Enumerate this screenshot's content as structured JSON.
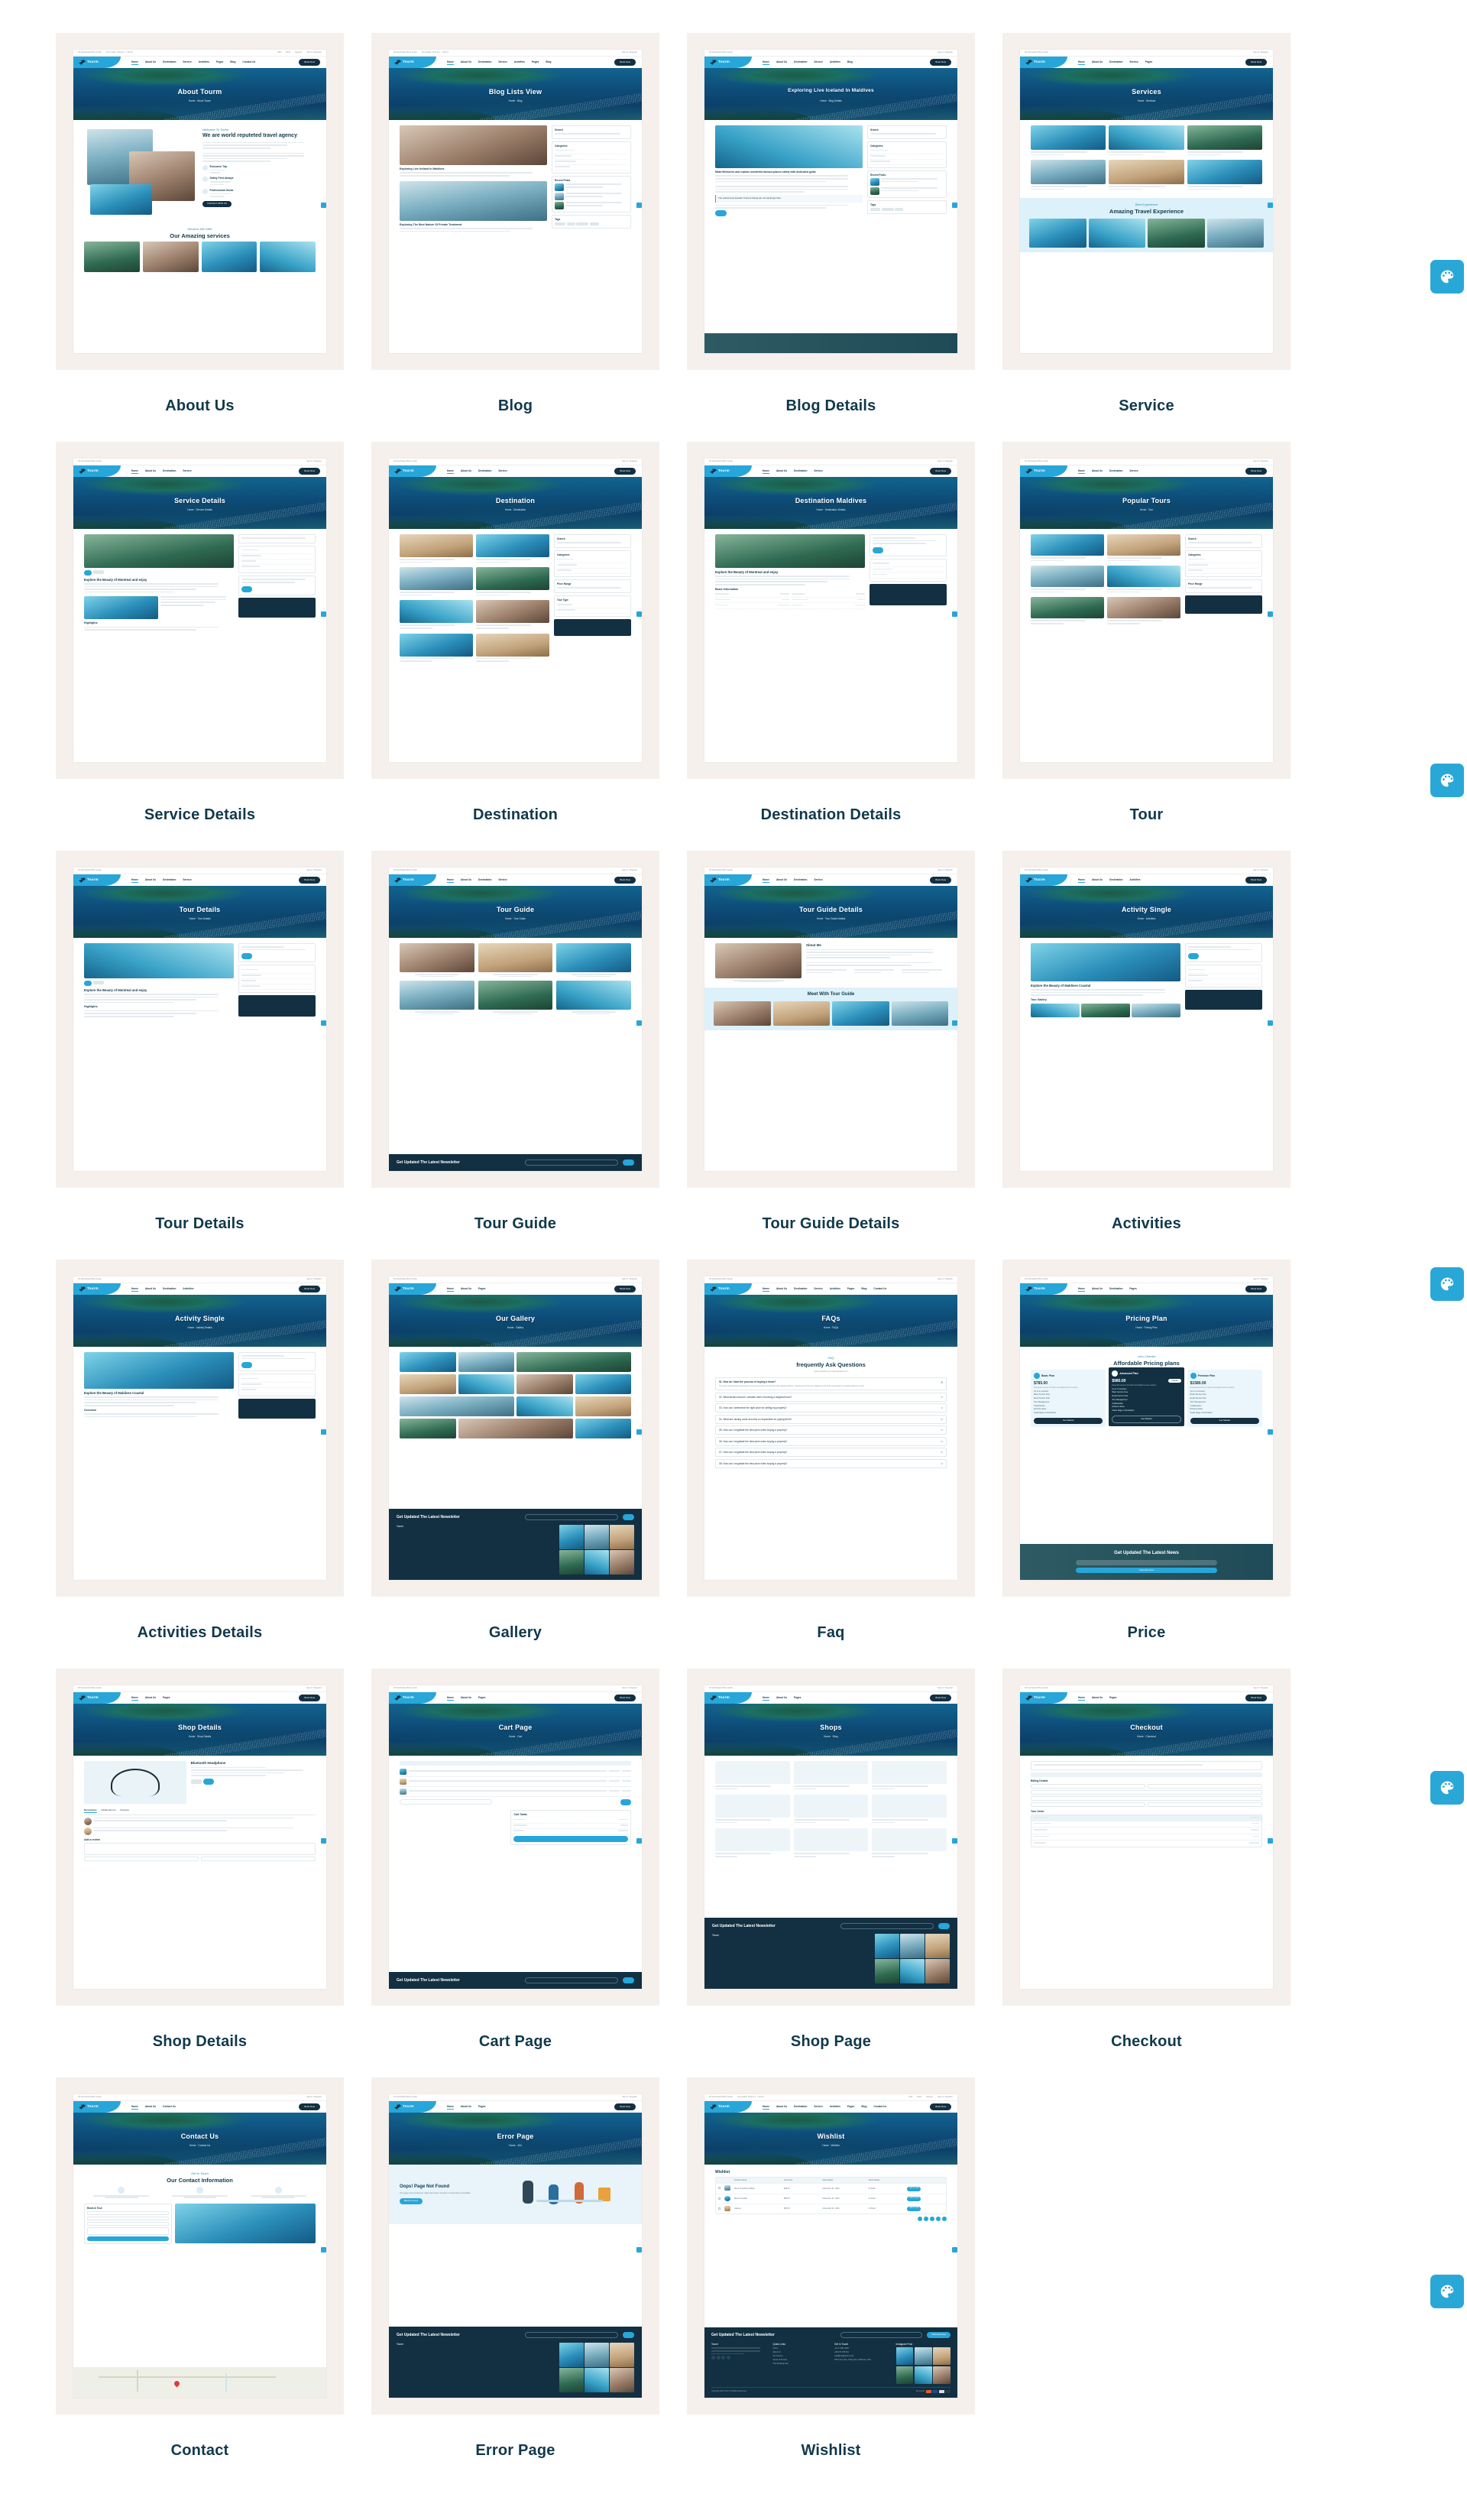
{
  "page": {
    "background": "#ffffff",
    "card_background": "#f5f0ec",
    "label_color": "#11394b",
    "accent": "#27a6d9",
    "dark": "#123042"
  },
  "brand": {
    "name": "Tourm",
    "tagline": "Explore World",
    "topbar_left": [
      "25 Southwater Blvd, Austin",
      "Sun-Friday: 8.00 am - 7.00 pm"
    ],
    "topbar_right": [
      "USD",
      "ENG",
      "Support",
      "Sign In / Register"
    ],
    "nav": [
      {
        "label": "Home",
        "active": true
      },
      {
        "label": "About Us",
        "active": false
      },
      {
        "label": "Destination",
        "active": false
      },
      {
        "label": "Service",
        "active": false
      },
      {
        "label": "Activities",
        "active": false
      },
      {
        "label": "Pages",
        "active": false
      },
      {
        "label": "Blog",
        "active": false
      },
      {
        "label": "Contact Us",
        "active": false
      }
    ],
    "nav_button": "Book Now"
  },
  "fabs": [
    {
      "name": "palette-button-1",
      "icon": "palette-icon"
    },
    {
      "name": "palette-button-2",
      "icon": "palette-icon"
    },
    {
      "name": "palette-button-3",
      "icon": "palette-icon"
    },
    {
      "name": "palette-button-4",
      "icon": "palette-icon"
    },
    {
      "name": "palette-button-5",
      "icon": "palette-icon"
    },
    {
      "name": "palette-button-6",
      "icon": "palette-icon"
    }
  ],
  "cards": [
    {
      "label": "About Us",
      "hero_title": "About Tourm",
      "breadcrumb": "Home  ·  About Tourm",
      "script_sub": "Welcome To Tourm",
      "headline": "We are world reputeted travel agency",
      "features": [
        "Exclusive Trip",
        "Safety First Always",
        "Professional Guide"
      ],
      "cta": "CONTACT WITH US",
      "section2_sub": "Services We Offer",
      "section2_title": "Our Amazing services"
    },
    {
      "label": "Blog",
      "hero_title": "Blog Lists View",
      "breadcrumb": "Home  ·  Blog",
      "post_title": "Exploring Live Iceland In Maldives",
      "post_title2": "Exploring The Best Nature Of Private Treatment",
      "sidebar_sections": [
        "Search",
        "Categories",
        "Recent Posts",
        "Tags"
      ]
    },
    {
      "label": "Blog Details",
      "hero_title": "Exploring Live Iceland In Maldives",
      "breadcrumb": "Home  ·  Blog Details",
      "section_heading": "Make Memories and explore wonderful famous places safely with dedicated guide",
      "quote": "The world's best traveller Travel & Sweat are normal things here",
      "sidebar_sections": [
        "Search",
        "Categories",
        "Recent Posts",
        "Tags"
      ]
    },
    {
      "label": "Service",
      "hero_title": "Services",
      "breadcrumb": "Home  ·  Services",
      "section_sub": "Best Experience",
      "section_title": "Amazing Travel Experience"
    },
    {
      "label": "Service Details",
      "hero_title": "Service Details",
      "breadcrumb": "Home  ·  Service Details",
      "section_title": "Explore the Beauty of Montreal and enjoy",
      "sub_title": "Highlights"
    },
    {
      "label": "Destination",
      "hero_title": "Destination",
      "breadcrumb": "Home  ·  Destination",
      "sidebar_sections": [
        "Search",
        "Categories",
        "Price Range",
        "Tour Type"
      ]
    },
    {
      "label": "Destination Details",
      "hero_title": "Destination Maldives",
      "breadcrumb": "Home  ·  Destination Details",
      "section_title": "Explore the Beauty of Montreal and enjoy",
      "sub_title": "Basic Information"
    },
    {
      "label": "Tour",
      "hero_title": "Popular Tours",
      "breadcrumb": "Home  ·  Tour",
      "sidebar_sections": [
        "Search",
        "Categories",
        "Price Range",
        "Tour Type"
      ]
    },
    {
      "label": "Tour Details",
      "hero_title": "Tour Details",
      "breadcrumb": "Home  ·  Tour Details",
      "section_title": "Explore the Beauty of Montreal and enjoy",
      "sub_title": "Highlights"
    },
    {
      "label": "Tour Guide",
      "hero_title": "Tour Guide",
      "breadcrumb": "Home  ·  Tour Guide",
      "newsletter_title": "Get Updated The Latest Newsletter"
    },
    {
      "label": "Tour Guide Details",
      "hero_title": "Tour Guide Details",
      "breadcrumb": "Home  ·  Tour Guide Details",
      "about_title": "About Me",
      "section_title": "Meet With Tour Guide"
    },
    {
      "label": "Activities",
      "hero_title": "Activity Single",
      "breadcrumb": "Home  ·  Activities",
      "section_title": "Explore the Beauty of Maldives Coastal",
      "sub_title": "Tour Gallery"
    },
    {
      "label": "Activities Details",
      "hero_title": "Activity Single",
      "breadcrumb": "Home  ·  Activity Details",
      "section_title": "Explore the Beauty of Maldives Coastal",
      "sub_title": "Overview"
    },
    {
      "label": "Gallery",
      "hero_title": "Our Gallery",
      "breadcrumb": "Home  ·  Gallery",
      "newsletter_title": "Get Updated The Latest Newsletter"
    },
    {
      "label": "Faq",
      "hero_title": "FAQs",
      "breadcrumb": "Home  ·  FAQs",
      "script_sub": "FAQ",
      "headline": "frequently Ask Questions",
      "note": "Have questions you want answers to?",
      "items": [
        "01. How do I start the process of buying a home?",
        "02. What factors should I consider when choosing a neighborhood?",
        "03. How can I determine the right price for selling my property?",
        "04. What are closing costs and who is responsible for paying them?",
        "05. How can I negotiate the best price when buying a property?",
        "06. How can I negotiate the best price when buying a property?",
        "07. How can I negotiate the best price when buying a property?",
        "08. How can I negotiate the best price when buying a property?"
      ],
      "answer": "The open concept layout seamlessly connects the living room with the fully equipped kitchen, boasting top-of-the-line appliances and all the essentials for preparing delicious meals."
    },
    {
      "label": "Price",
      "hero_title": "Pricing Plan",
      "breadcrumb": "Home  ·  Pricing Plan",
      "script_sub": "Let's Checkin",
      "headline": "Affordable Pricing plans",
      "plans": [
        {
          "name": "Basic Plan",
          "price": "$785.00",
          "per": "Per Night",
          "desc": "Essential services for basic and digital service seeking",
          "featured": false
        },
        {
          "name": "Advanced Plan",
          "price": "$980.00",
          "per": "Per Night",
          "desc": "Essential services for basic and digital service seeking",
          "featured": true,
          "badge": "Popular"
        },
        {
          "name": "Premium Plan",
          "price": "$1580.00",
          "per": "Per Night",
          "desc": "Essential services for basic and digital service seeking",
          "featured": false
        }
      ],
      "plan_features": [
        "Up to 3 members",
        "Basic Service Free",
        "Email Service Fast",
        "Tour Management",
        "Collaboration",
        "Entrance Ease",
        "Guide Rage in Destination"
      ],
      "plan_cta": "Get Started",
      "newsletter_title": "Get Updated The Latest News",
      "newsletter_placeholder": "Your Email",
      "newsletter_cta": "Subscribe Now"
    },
    {
      "label": "Shop Details",
      "hero_title": "Shop Details",
      "breadcrumb": "Home  ·  Shop Details",
      "product": "Bluetooth Headphone",
      "tabs": [
        "Description",
        "Additional Info",
        "Reviews"
      ],
      "form_title": "Add a review"
    },
    {
      "label": "Cart Page",
      "hero_title": "Cart Page",
      "breadcrumb": "Home  ·  Cart",
      "totals_title": "Cart Totals",
      "newsletter_title": "Get Updated The Latest Newsletter"
    },
    {
      "label": "Shop Page",
      "hero_title": "Shops",
      "breadcrumb": "Home  ·  Shop",
      "newsletter_title": "Get Updated The Latest Newsletter"
    },
    {
      "label": "Checkout",
      "hero_title": "Checkout",
      "breadcrumb": "Home  ·  Checkout",
      "billing_title": "Billing Details",
      "order_title": "Your Order"
    },
    {
      "label": "Contact",
      "hero_title": "Contact Us",
      "breadcrumb": "Home  ·  Contact Us",
      "script_sub": "Get In Touch",
      "headline": "Our Contact Information",
      "form_title": "Book A Tour"
    },
    {
      "label": "Error Page",
      "hero_title": "Error Page",
      "breadcrumb": "Home  ·  404",
      "headline": "Oops! Page Not Found",
      "note": "The page you're looking for might have been removed or temporarily unavailable.",
      "cta": "Back To Home",
      "newsletter_title": "Get Updated The Latest Newsletter"
    },
    {
      "label": "Wishlist",
      "hero_title": "Wishlist",
      "breadcrumb": "Home  ·  Wishlist",
      "table_title": "Wishlist",
      "columns": [
        "Product Name",
        "Unit Price",
        "Date Added",
        "Stock Status"
      ],
      "rows": [
        {
          "name": "Mesh Snowboard White",
          "price": "$45.00",
          "date": "November 21, 2024",
          "status": "In Stock",
          "cta": "Add To Cart"
        },
        {
          "name": "Beach Football",
          "price": "$56.00",
          "date": "November 21, 2024",
          "status": "In Stock",
          "cta": "Add To Cart"
        },
        {
          "name": "Glasses",
          "price": "$35.00",
          "date": "November 21, 2024",
          "status": "In Stock",
          "cta": "Add To Cart"
        }
      ],
      "footer": {
        "newsletter_title": "Get Updated The Latest Newsletter",
        "placeholder": "Your Email",
        "cta": "Subscribe Now",
        "columns": [
          "Quick Links",
          "Get In Touch",
          "Instagram Post"
        ],
        "quick_links": [
          "Home",
          "About Us",
          "Our Service",
          "Terms of Service",
          "Tour Booking Now"
        ],
        "contacts": [
          "+61 2 3456 1800",
          "+68 974 345 310",
          "mail@123@tourm.com",
          "support99@tourm.com",
          "789 Inner Lane, Holly park, California, USA"
        ],
        "copyright": "Copyright 2024 Tourm. All Rights Reserved.",
        "pay_label": "We Accept"
      }
    }
  ]
}
